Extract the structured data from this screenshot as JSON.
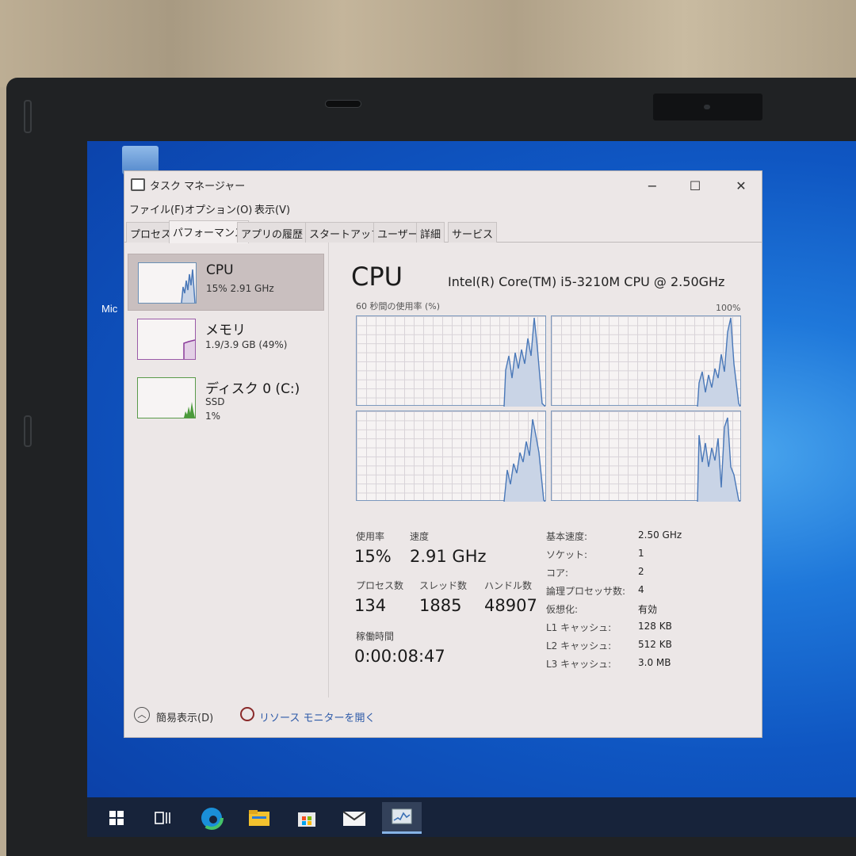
{
  "window": {
    "title": "タスク マネージャー",
    "controls": {
      "minimize": "−",
      "maximize": "☐",
      "close": "✕"
    }
  },
  "menu": [
    "ファイル(F)",
    "オプション(O)",
    "表示(V)"
  ],
  "tabs": [
    "プロセス",
    "パフォーマンス",
    "アプリの履歴",
    "スタートアップ",
    "ユーザー",
    "詳細",
    "サービス"
  ],
  "active_tab": "パフォーマンス",
  "resources": [
    {
      "name": "CPU",
      "line1": "15% 2.91 GHz",
      "line2": ""
    },
    {
      "name": "メモリ",
      "line1": "1.9/3.9 GB (49%)",
      "line2": ""
    },
    {
      "name": "ディスク 0 (C:)",
      "line1": "SSD",
      "line2": "1%"
    }
  ],
  "cpu": {
    "title": "CPU",
    "model": "Intel(R) Core(TM) i5-3210M CPU @ 2.50GHz",
    "graph_label": "60 秒間の使用率 (%)",
    "graph_max": "100%",
    "stats": {
      "usage_label": "使用率",
      "usage": "15%",
      "speed_label": "速度",
      "speed": "2.91 GHz",
      "processes_label": "プロセス数",
      "processes": "134",
      "threads_label": "スレッド数",
      "threads": "1885",
      "handles_label": "ハンドル数",
      "handles": "48907",
      "uptime_label": "稼働時間",
      "uptime": "0:00:08:47"
    },
    "specs": [
      {
        "label": "基本速度:",
        "value": "2.50 GHz"
      },
      {
        "label": "ソケット:",
        "value": "1"
      },
      {
        "label": "コア:",
        "value": "2"
      },
      {
        "label": "論理プロセッサ数:",
        "value": "4"
      },
      {
        "label": "仮想化:",
        "value": "有効"
      },
      {
        "label": "L1 キャッシュ:",
        "value": "128 KB"
      },
      {
        "label": "L2 キャッシュ:",
        "value": "512 KB"
      },
      {
        "label": "L3 キャッシュ:",
        "value": "3.0 MB"
      }
    ]
  },
  "footer": {
    "fewer_details": "簡易表示(D)",
    "resource_monitor": "リソース モニターを開く"
  },
  "desktop": {
    "icon_label": "Mic"
  },
  "taskbar": [
    "start-icon",
    "task-view-icon",
    "edge-icon",
    "file-explorer-icon",
    "store-icon",
    "mail-icon",
    "task-manager-icon"
  ],
  "colors": {
    "graph_line": "#4a78b8",
    "graph_fill": "#c9d4e6",
    "disk_fill": "#4a9a3a",
    "memory_line": "#8a3a9a",
    "desktop": "#1465d4"
  }
}
